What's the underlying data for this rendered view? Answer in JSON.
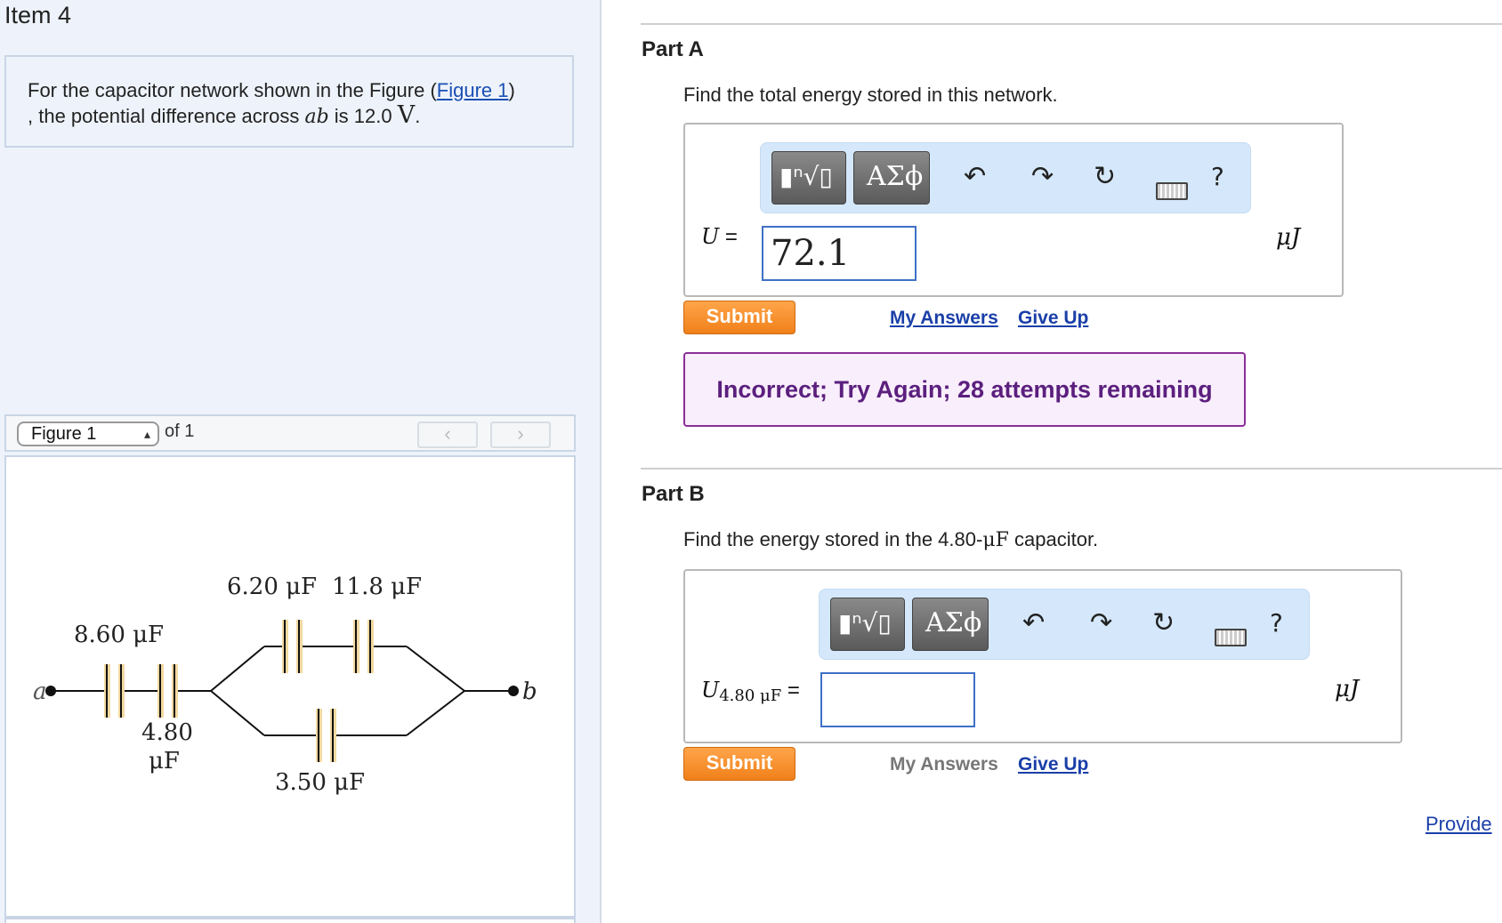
{
  "item": {
    "title": "Item 4"
  },
  "question": {
    "prefix": "For the capacitor network shown in the Figure (",
    "figure_link": "Figure 1",
    "mid": ")",
    "line2": ", the potential difference across ",
    "var": "ab",
    "is_text": " is 12.0 ",
    "unit": "V",
    "end": "."
  },
  "figure_nav": {
    "select_value": "Figure 1",
    "of_text": "of 1",
    "prev_icon": "chevron-left-icon",
    "next_icon": "chevron-right-icon"
  },
  "circuit": {
    "node_a": "a",
    "node_b": "b",
    "c1": "8.60 μF",
    "c2_line1": "4.80",
    "c2_line2": "μF",
    "c3": "6.20 μF",
    "c4": "11.8 μF",
    "c5": "3.50 μF",
    "plate_color": "#f2d9a0"
  },
  "part_a": {
    "title": "Part A",
    "prompt": "Find the total energy stored in this network.",
    "var": "U",
    "eq": " = ",
    "answer_value": "72.1",
    "unit": "μJ",
    "submit_label": "Submit",
    "my_answers_label": "My Answers",
    "give_up_label": "Give Up",
    "feedback": "Incorrect; Try Again; 28 attempts remaining"
  },
  "part_b": {
    "title": "Part B",
    "prompt_prefix": "Find the energy stored in the 4.80-",
    "prompt_unit": "μF",
    "prompt_suffix": " capacitor.",
    "var": "U",
    "var_sub": "4.80 μF",
    "eq": " = ",
    "answer_value": "",
    "unit": "μJ",
    "submit_label": "Submit",
    "my_answers_label": "My Answers",
    "give_up_label": "Give Up"
  },
  "toolbar": {
    "templates_icon": "▮ⁿ√▯",
    "greek_label": "ΑΣϕ",
    "undo_icon": "undo-icon",
    "redo_icon": "redo-icon",
    "reset_icon": "reset-icon",
    "keyboard_icon": "keyboard-icon",
    "help_label": "?"
  },
  "footer": {
    "provide_link": "Provide"
  },
  "colors": {
    "left_bg": "#eef3fb",
    "submit_orange": "#f0801a",
    "link_blue": "#1a3fa8",
    "feedback_purple": "#5b1f7e"
  }
}
